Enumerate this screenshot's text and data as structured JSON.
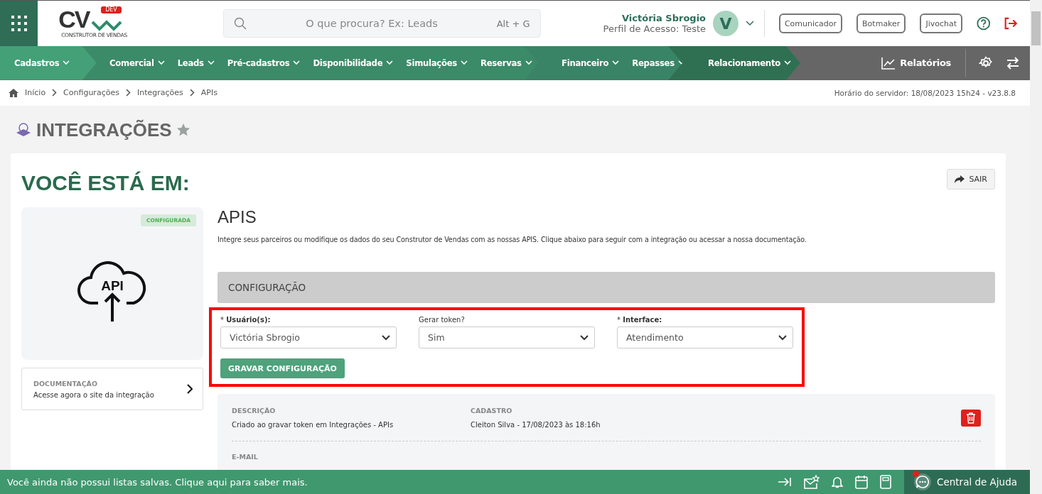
{
  "header": {
    "logo": {
      "mark": "CV",
      "badge": "DEV",
      "tagline": "CONSTRUTOR DE VENDAS"
    },
    "search": {
      "placeholder": "O que procura? Ex: Leads",
      "shortcut": "Alt + G"
    },
    "user": {
      "name": "Victória Sbrogio",
      "profile": "Perfil de Acesso: Teste",
      "initial": "V"
    },
    "buttons": [
      "Comunicador",
      "Botmaker",
      "Jivochat"
    ]
  },
  "nav": {
    "groups": [
      {
        "color": "#43a077",
        "items": [
          "Cadastros"
        ]
      },
      {
        "color": "#3b8a68",
        "items": [
          "Comercial",
          "Leads",
          "Pré-cadastros",
          "Disponibilidade",
          "Simulações",
          "Reservas"
        ]
      },
      {
        "color": "#398466",
        "items": [
          "Financeiro",
          "Repasses"
        ]
      },
      {
        "color": "#2f7052",
        "items": [
          "Relacionamento"
        ]
      }
    ],
    "reports": "Relatórios"
  },
  "breadcrumb": [
    "Início",
    "Configurações",
    "Integrações",
    "APIs"
  ],
  "server_time": "Horário do servidor: 18/08/2023 15h24 - v23.8.8",
  "page_title": "INTEGRAÇÕES",
  "favorite": false,
  "card": {
    "heading": "VOCÊ ESTÁ EM:",
    "exit": "SAIR",
    "integration": {
      "status": "CONFIGURADA",
      "icon_text": "API"
    },
    "docs": {
      "label": "DOCUMENTAÇÃO",
      "text": "Acesse agora o site da integração"
    },
    "title": "APIS",
    "description": "Integre seus parceiros ou modifique os dados do seu Construtor de Vendas com as nossas APIS. Clique abaixo para seguir com a integração ou acessar a nossa documentação.",
    "section": "CONFIGURAÇÃO",
    "highlighted": true,
    "fields": [
      {
        "label": "* **Usuário(s):**",
        "value": "Victória Sbrogio"
      },
      {
        "label": "Gerar token?",
        "value": "Sim"
      },
      {
        "label": "* **Interface:**",
        "value": "Atendimento"
      }
    ],
    "save": "GRAVAR CONFIGURAÇÃO",
    "token": {
      "columns": [
        {
          "label": "DESCRIÇÃO",
          "value": "Criado ao gravar token em Integrações - APIs"
        },
        {
          "label": "CADASTRO",
          "value": "Cleiton Silva - 17/08/2023 às 18:16h"
        }
      ],
      "next_label": "E-MAIL"
    }
  },
  "footer": {
    "message": "Você ainda não possui listas salvas. Clique aqui para saber mais.",
    "help": "Central de Ajuda",
    "help_unread": true
  }
}
